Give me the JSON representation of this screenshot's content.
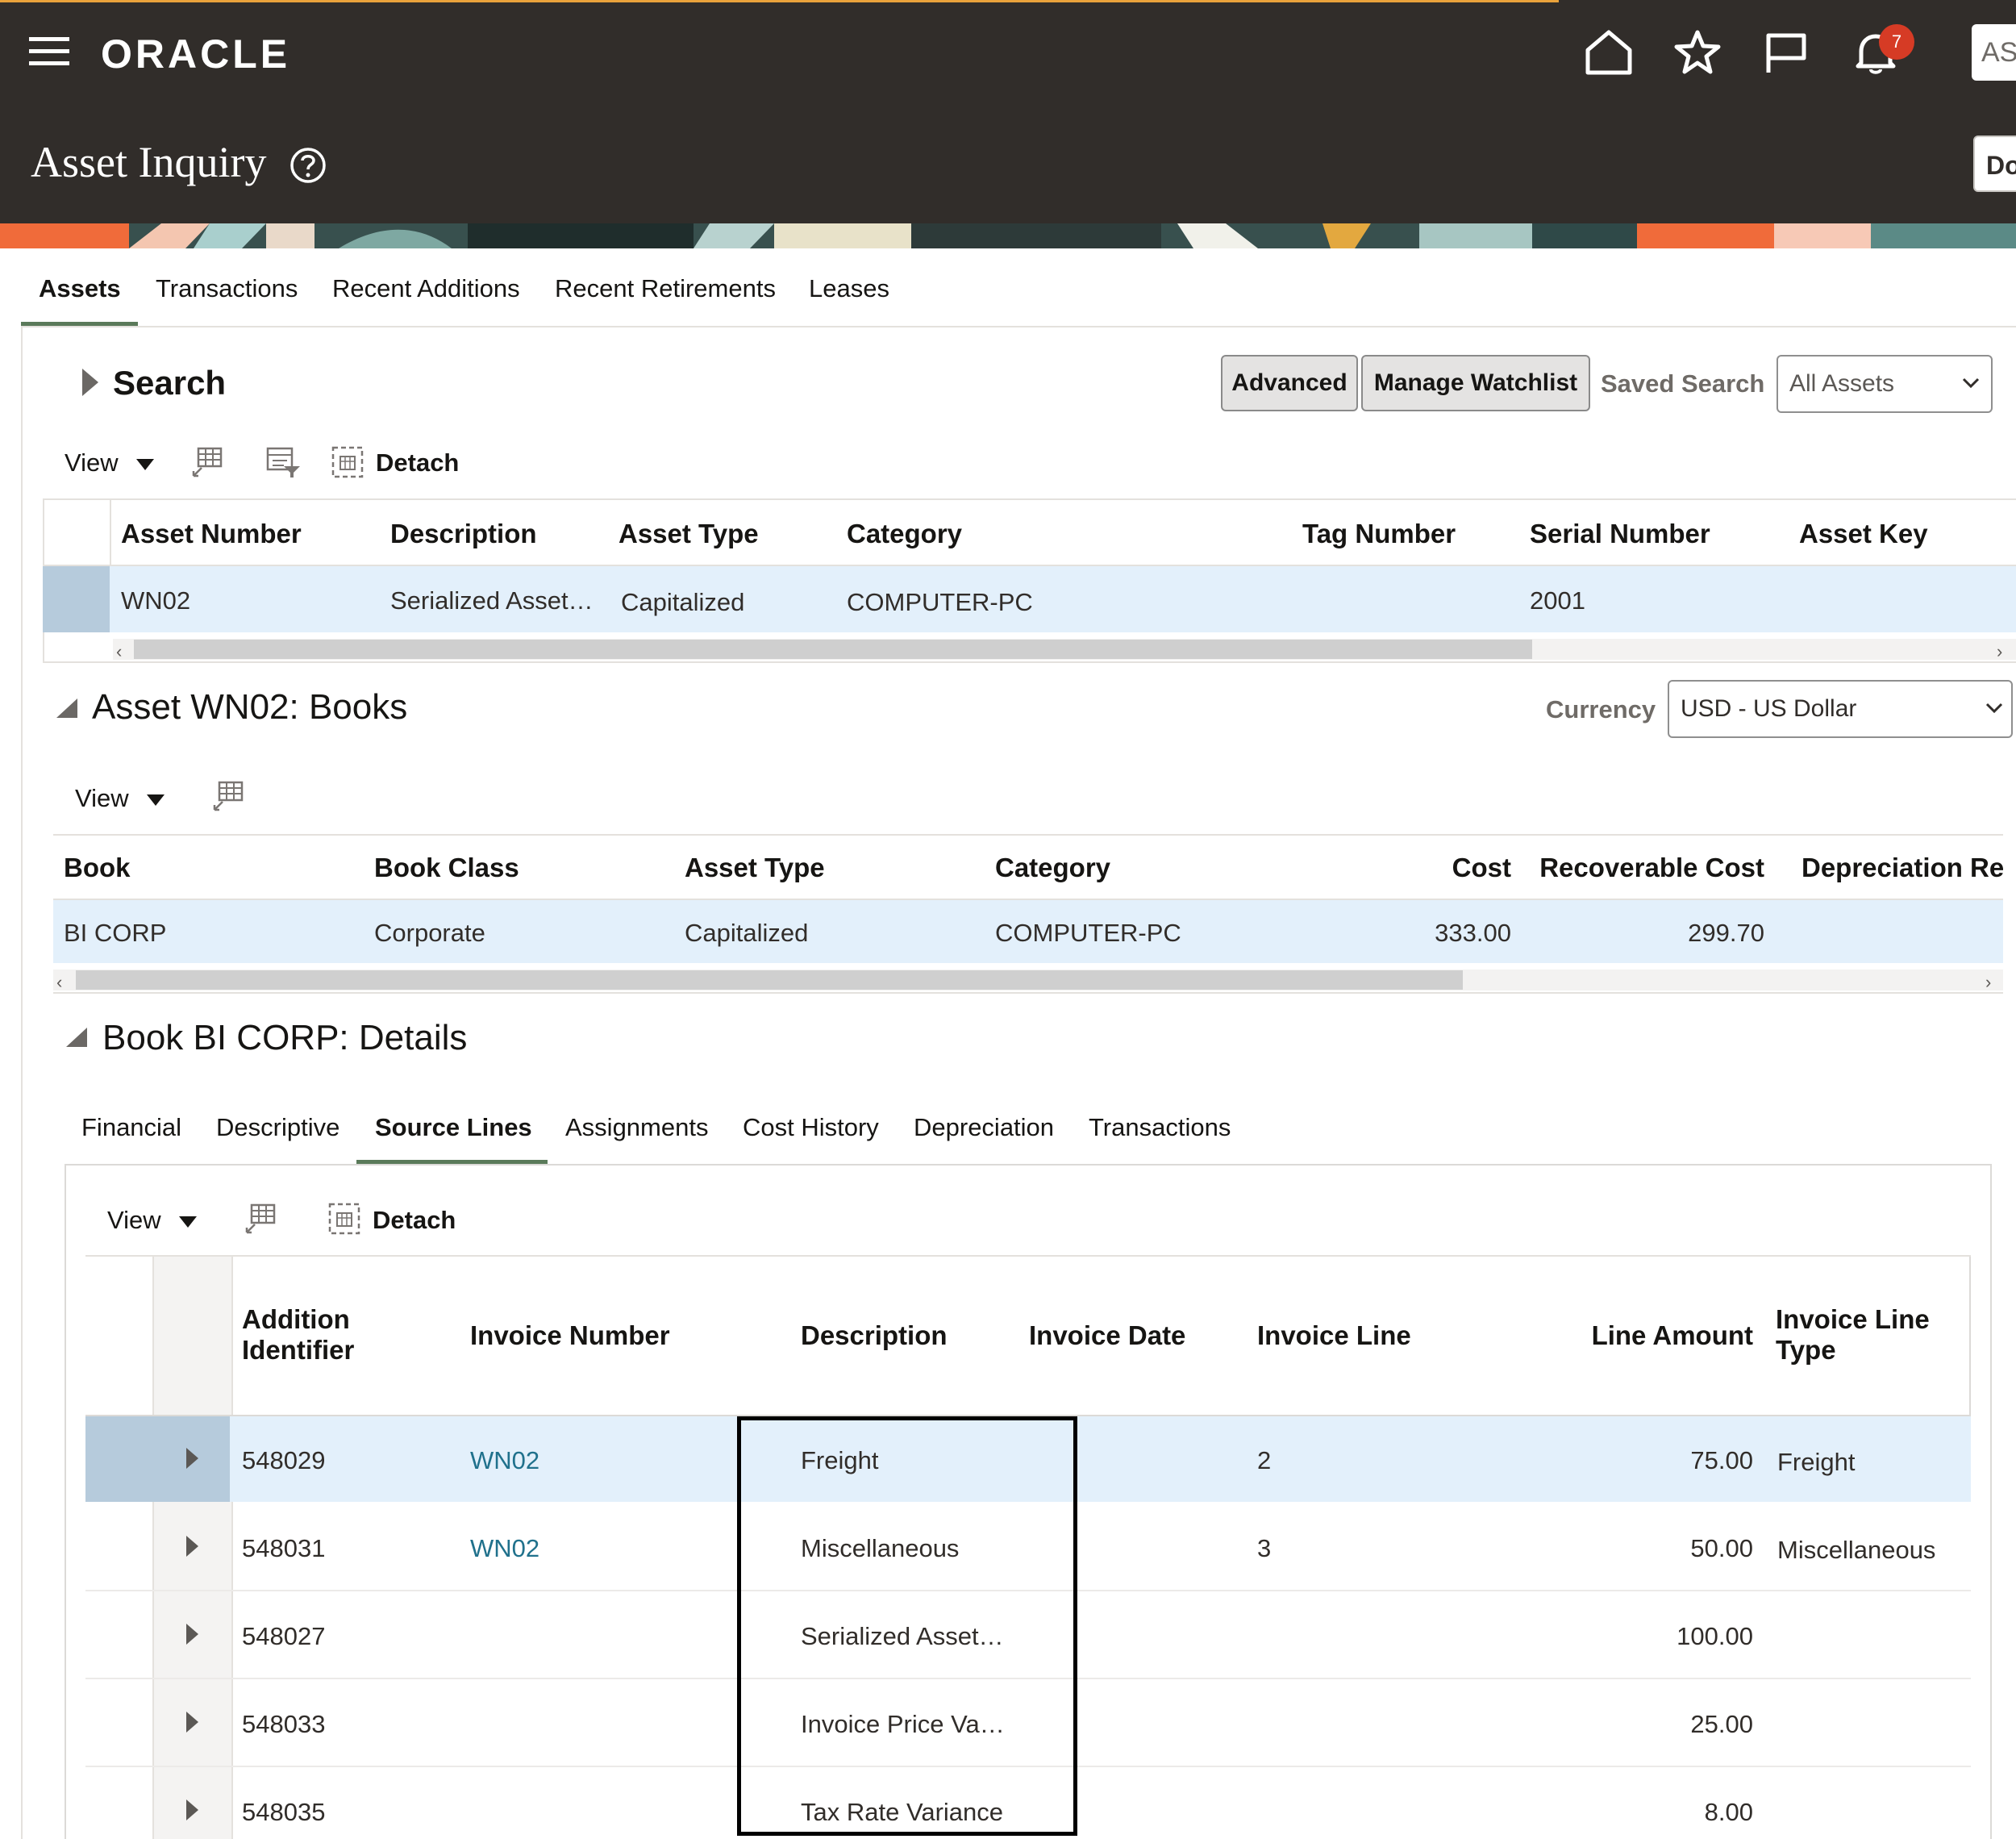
{
  "header": {
    "brand": "ORACLE",
    "title": "Asset Inquiry",
    "notifications_count": "7",
    "user_initials": "AS",
    "done_label": "Do"
  },
  "tabs": [
    "Assets",
    "Transactions",
    "Recent Additions",
    "Recent Retirements",
    "Leases"
  ],
  "search": {
    "title": "Search",
    "advanced_label": "Advanced",
    "manage_watchlist_label": "Manage Watchlist",
    "saved_search_label": "Saved Search",
    "saved_search_value": "All Assets"
  },
  "toolbar": {
    "view_label": "View",
    "detach_label": "Detach"
  },
  "assets_table": {
    "headers": [
      "Asset Number",
      "Description",
      "Asset Type",
      "Category",
      "Tag Number",
      "Serial Number",
      "Asset Key"
    ],
    "rows": [
      [
        "WN02",
        "Serialized Asset…",
        "Capitalized",
        "COMPUTER-PC",
        "",
        "2001",
        ""
      ]
    ]
  },
  "books": {
    "title": "Asset WN02: Books",
    "currency_label": "Currency",
    "currency_value": "USD - US Dollar",
    "headers": [
      "Book",
      "Book Class",
      "Asset Type",
      "Category",
      "Cost",
      "Recoverable Cost",
      "Depreciation Re"
    ],
    "rows": [
      [
        "BI CORP",
        "Corporate",
        "Capitalized",
        "COMPUTER-PC",
        "333.00",
        "299.70",
        ""
      ]
    ]
  },
  "details": {
    "title": "Book BI CORP: Details",
    "tabs": [
      "Financial",
      "Descriptive",
      "Source Lines",
      "Assignments",
      "Cost History",
      "Depreciation",
      "Transactions"
    ],
    "active_tab": "Source Lines",
    "headers": [
      "Addition Identifier",
      "Invoice Number",
      "Description",
      "Invoice Date",
      "Invoice Line",
      "Line Amount",
      "Invoice Line Type"
    ],
    "rows": [
      [
        "548029",
        "WN02",
        "Freight",
        "",
        "2",
        "75.00",
        "Freight"
      ],
      [
        "548031",
        "WN02",
        "Miscellaneous",
        "",
        "3",
        "50.00",
        "Miscellaneous"
      ],
      [
        "548027",
        "",
        "Serialized Asset…",
        "",
        "",
        "100.00",
        ""
      ],
      [
        "548033",
        "",
        "Invoice Price Va…",
        "",
        "",
        "25.00",
        ""
      ],
      [
        "548035",
        "",
        "Tax Rate Variance",
        "",
        "",
        "8.00",
        ""
      ]
    ]
  }
}
